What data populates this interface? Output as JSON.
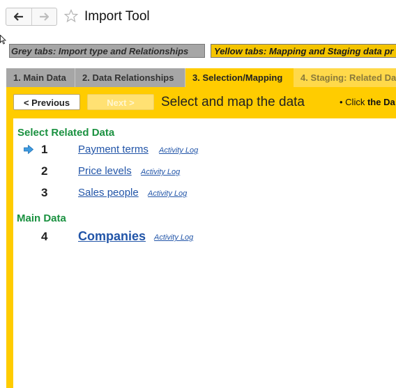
{
  "window": {
    "title": "Import Tool"
  },
  "legend": {
    "grey": "Grey tabs: Import type and Relationships",
    "yellow": "Yellow tabs: Mapping and Staging data pr"
  },
  "tabs": [
    {
      "label": "1. Main Data",
      "state": "grey"
    },
    {
      "label": "2. Data Relationships",
      "state": "grey"
    },
    {
      "label": "3. Selection/Mapping",
      "state": "active"
    },
    {
      "label": "4. Staging: Related Da",
      "state": "inactive"
    }
  ],
  "toolbar": {
    "previous_label": "< Previous",
    "next_label": "Next >",
    "heading": "Select and map the data",
    "hint_prefix": "Click",
    "hint_bold": "the Da"
  },
  "sections": {
    "related": {
      "heading": "Select Related Data",
      "items": [
        {
          "number": "1",
          "label": "Payment terms",
          "log": "Activity Log",
          "current": true
        },
        {
          "number": "2",
          "label": "Price levels",
          "log": "Activity Log",
          "current": false
        },
        {
          "number": "3",
          "label": "Sales people",
          "log": "Activity Log",
          "current": false
        }
      ]
    },
    "main": {
      "heading": "Main Data",
      "items": [
        {
          "number": "4",
          "label": "Companies",
          "log": "Activity Log"
        }
      ]
    }
  },
  "colors": {
    "accent_yellow": "#ffcc00",
    "tab_grey": "#a6a6a6",
    "heading_green": "#1a9140",
    "link_blue": "#2255a8"
  }
}
